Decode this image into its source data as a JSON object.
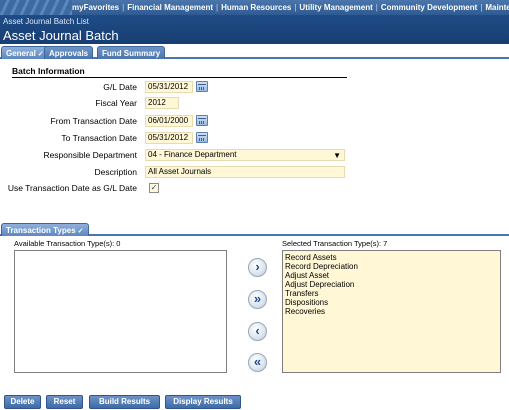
{
  "topnav": {
    "items": [
      "myFavorites",
      "Financial Management",
      "Human Resources",
      "Utility Management",
      "Community Development",
      "Maintenar"
    ]
  },
  "header": {
    "breadcrumb": "Asset Journal Batch List",
    "title": "Asset Journal Batch"
  },
  "tabs": [
    {
      "label": "General",
      "mark": "✓"
    },
    {
      "label": "Approvals",
      "mark": ""
    },
    {
      "label": "Fund Summary",
      "mark": ""
    }
  ],
  "batch_info": {
    "section_title": "Batch Information",
    "gl_date": {
      "label": "G/L Date",
      "value": "05/31/2012"
    },
    "fiscal_year": {
      "label": "Fiscal Year",
      "value": "2012"
    },
    "from_date": {
      "label": "From Transaction Date",
      "value": "06/01/2000"
    },
    "to_date": {
      "label": "To Transaction Date",
      "value": "05/31/2012"
    },
    "department": {
      "label": "Responsible Department",
      "value": "04 - Finance Department",
      "arrow": "▼"
    },
    "description": {
      "label": "Description",
      "value": "All Asset Journals"
    },
    "use_trans_date": {
      "label": "Use Transaction Date as G/L Date",
      "checked": "✓"
    }
  },
  "transaction_types": {
    "tab_label": "Transaction Types",
    "tab_mark": "✓",
    "available_caption": "Available Transaction Type(s): 0",
    "selected_caption": "Selected Transaction Type(s): 7",
    "selected_items": [
      "Record Assets",
      "Record Depreciation",
      "Adjust Asset",
      "Adjust Depreciation",
      "Transfers",
      "Dispositions",
      "Recoveries"
    ],
    "buttons": {
      "add_one": "›",
      "add_all": "»",
      "remove_one": "‹",
      "remove_all": "«"
    }
  },
  "footer_buttons": {
    "delete": "Delete",
    "reset": "Reset",
    "build": "Build Results",
    "display": "Display Results"
  }
}
